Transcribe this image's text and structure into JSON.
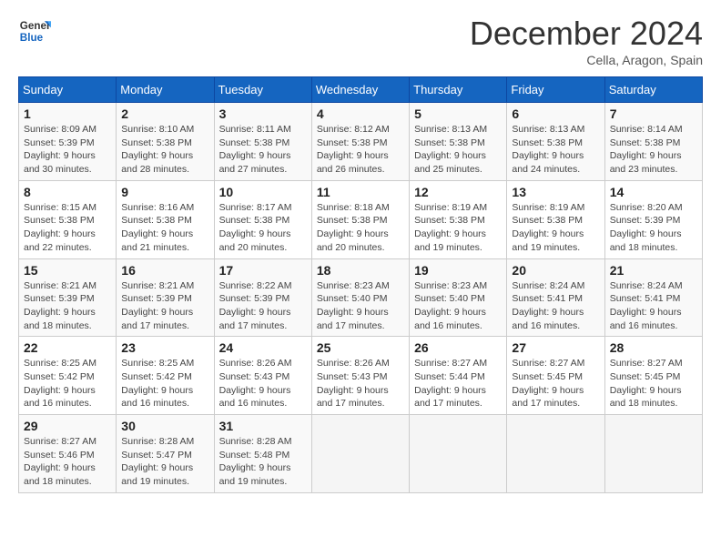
{
  "header": {
    "logo_text_general": "General",
    "logo_text_blue": "Blue",
    "month_title": "December 2024",
    "location": "Cella, Aragon, Spain"
  },
  "weekdays": [
    "Sunday",
    "Monday",
    "Tuesday",
    "Wednesday",
    "Thursday",
    "Friday",
    "Saturday"
  ],
  "weeks": [
    [
      {
        "day": "1",
        "sunrise": "Sunrise: 8:09 AM",
        "sunset": "Sunset: 5:39 PM",
        "daylight": "Daylight: 9 hours and 30 minutes."
      },
      {
        "day": "2",
        "sunrise": "Sunrise: 8:10 AM",
        "sunset": "Sunset: 5:38 PM",
        "daylight": "Daylight: 9 hours and 28 minutes."
      },
      {
        "day": "3",
        "sunrise": "Sunrise: 8:11 AM",
        "sunset": "Sunset: 5:38 PM",
        "daylight": "Daylight: 9 hours and 27 minutes."
      },
      {
        "day": "4",
        "sunrise": "Sunrise: 8:12 AM",
        "sunset": "Sunset: 5:38 PM",
        "daylight": "Daylight: 9 hours and 26 minutes."
      },
      {
        "day": "5",
        "sunrise": "Sunrise: 8:13 AM",
        "sunset": "Sunset: 5:38 PM",
        "daylight": "Daylight: 9 hours and 25 minutes."
      },
      {
        "day": "6",
        "sunrise": "Sunrise: 8:13 AM",
        "sunset": "Sunset: 5:38 PM",
        "daylight": "Daylight: 9 hours and 24 minutes."
      },
      {
        "day": "7",
        "sunrise": "Sunrise: 8:14 AM",
        "sunset": "Sunset: 5:38 PM",
        "daylight": "Daylight: 9 hours and 23 minutes."
      }
    ],
    [
      {
        "day": "8",
        "sunrise": "Sunrise: 8:15 AM",
        "sunset": "Sunset: 5:38 PM",
        "daylight": "Daylight: 9 hours and 22 minutes."
      },
      {
        "day": "9",
        "sunrise": "Sunrise: 8:16 AM",
        "sunset": "Sunset: 5:38 PM",
        "daylight": "Daylight: 9 hours and 21 minutes."
      },
      {
        "day": "10",
        "sunrise": "Sunrise: 8:17 AM",
        "sunset": "Sunset: 5:38 PM",
        "daylight": "Daylight: 9 hours and 20 minutes."
      },
      {
        "day": "11",
        "sunrise": "Sunrise: 8:18 AM",
        "sunset": "Sunset: 5:38 PM",
        "daylight": "Daylight: 9 hours and 20 minutes."
      },
      {
        "day": "12",
        "sunrise": "Sunrise: 8:19 AM",
        "sunset": "Sunset: 5:38 PM",
        "daylight": "Daylight: 9 hours and 19 minutes."
      },
      {
        "day": "13",
        "sunrise": "Sunrise: 8:19 AM",
        "sunset": "Sunset: 5:38 PM",
        "daylight": "Daylight: 9 hours and 19 minutes."
      },
      {
        "day": "14",
        "sunrise": "Sunrise: 8:20 AM",
        "sunset": "Sunset: 5:39 PM",
        "daylight": "Daylight: 9 hours and 18 minutes."
      }
    ],
    [
      {
        "day": "15",
        "sunrise": "Sunrise: 8:21 AM",
        "sunset": "Sunset: 5:39 PM",
        "daylight": "Daylight: 9 hours and 18 minutes."
      },
      {
        "day": "16",
        "sunrise": "Sunrise: 8:21 AM",
        "sunset": "Sunset: 5:39 PM",
        "daylight": "Daylight: 9 hours and 17 minutes."
      },
      {
        "day": "17",
        "sunrise": "Sunrise: 8:22 AM",
        "sunset": "Sunset: 5:39 PM",
        "daylight": "Daylight: 9 hours and 17 minutes."
      },
      {
        "day": "18",
        "sunrise": "Sunrise: 8:23 AM",
        "sunset": "Sunset: 5:40 PM",
        "daylight": "Daylight: 9 hours and 17 minutes."
      },
      {
        "day": "19",
        "sunrise": "Sunrise: 8:23 AM",
        "sunset": "Sunset: 5:40 PM",
        "daylight": "Daylight: 9 hours and 16 minutes."
      },
      {
        "day": "20",
        "sunrise": "Sunrise: 8:24 AM",
        "sunset": "Sunset: 5:41 PM",
        "daylight": "Daylight: 9 hours and 16 minutes."
      },
      {
        "day": "21",
        "sunrise": "Sunrise: 8:24 AM",
        "sunset": "Sunset: 5:41 PM",
        "daylight": "Daylight: 9 hours and 16 minutes."
      }
    ],
    [
      {
        "day": "22",
        "sunrise": "Sunrise: 8:25 AM",
        "sunset": "Sunset: 5:42 PM",
        "daylight": "Daylight: 9 hours and 16 minutes."
      },
      {
        "day": "23",
        "sunrise": "Sunrise: 8:25 AM",
        "sunset": "Sunset: 5:42 PM",
        "daylight": "Daylight: 9 hours and 16 minutes."
      },
      {
        "day": "24",
        "sunrise": "Sunrise: 8:26 AM",
        "sunset": "Sunset: 5:43 PM",
        "daylight": "Daylight: 9 hours and 16 minutes."
      },
      {
        "day": "25",
        "sunrise": "Sunrise: 8:26 AM",
        "sunset": "Sunset: 5:43 PM",
        "daylight": "Daylight: 9 hours and 17 minutes."
      },
      {
        "day": "26",
        "sunrise": "Sunrise: 8:27 AM",
        "sunset": "Sunset: 5:44 PM",
        "daylight": "Daylight: 9 hours and 17 minutes."
      },
      {
        "day": "27",
        "sunrise": "Sunrise: 8:27 AM",
        "sunset": "Sunset: 5:45 PM",
        "daylight": "Daylight: 9 hours and 17 minutes."
      },
      {
        "day": "28",
        "sunrise": "Sunrise: 8:27 AM",
        "sunset": "Sunset: 5:45 PM",
        "daylight": "Daylight: 9 hours and 18 minutes."
      }
    ],
    [
      {
        "day": "29",
        "sunrise": "Sunrise: 8:27 AM",
        "sunset": "Sunset: 5:46 PM",
        "daylight": "Daylight: 9 hours and 18 minutes."
      },
      {
        "day": "30",
        "sunrise": "Sunrise: 8:28 AM",
        "sunset": "Sunset: 5:47 PM",
        "daylight": "Daylight: 9 hours and 19 minutes."
      },
      {
        "day": "31",
        "sunrise": "Sunrise: 8:28 AM",
        "sunset": "Sunset: 5:48 PM",
        "daylight": "Daylight: 9 hours and 19 minutes."
      },
      null,
      null,
      null,
      null
    ]
  ]
}
